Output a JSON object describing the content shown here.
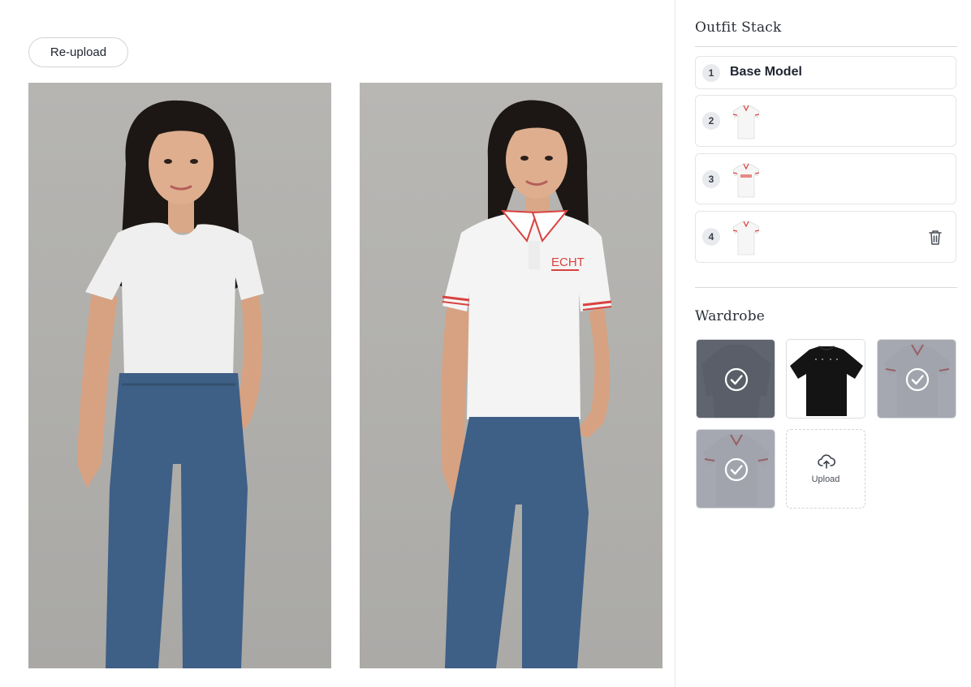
{
  "main": {
    "reupload_label": "Re-upload",
    "photos": [
      {
        "name": "original-model-photo",
        "top": "plain white crew-neck t-shirt",
        "bottom": "blue jeans"
      },
      {
        "name": "try-on-result-photo",
        "top": "white polo with red striped trim and ECHT logo",
        "bottom": "blue jeans"
      }
    ],
    "result_logo_text": "ECHT"
  },
  "sidebar": {
    "outfit_stack_title": "Outfit Stack",
    "stack": [
      {
        "number": "1",
        "label": "Base Model"
      },
      {
        "number": "2",
        "thumbnail": "white polo with red trim"
      },
      {
        "number": "3",
        "thumbnail": "white polo with ECHT logo"
      },
      {
        "number": "4",
        "thumbnail": "white polo with red trim",
        "delete_icon": "trash-icon"
      }
    ],
    "wardrobe_title": "Wardrobe",
    "wardrobe": [
      {
        "item": "dark long-sleeve shirt",
        "selected": true
      },
      {
        "item": "black oversized t-shirt",
        "selected": false
      },
      {
        "item": "white polo with red trim",
        "selected": true
      },
      {
        "item": "white polo with red trim",
        "selected": true
      }
    ],
    "upload_label": "Upload"
  },
  "colors": {
    "accent_trim": "#d9423f",
    "selected_overlay": "#6e7380",
    "border": "#e3e5e8",
    "badge_bg": "#e8eaed"
  }
}
